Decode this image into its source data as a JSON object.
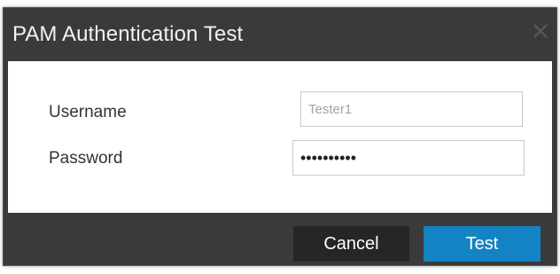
{
  "dialog": {
    "title": "PAM Authentication Test",
    "close_icon": "close-icon"
  },
  "form": {
    "username_label": "Username",
    "username_value": "Tester1",
    "password_label": "Password",
    "password_value": "••••••••••"
  },
  "footer": {
    "cancel_label": "Cancel",
    "test_label": "Test"
  },
  "colors": {
    "titlebar": "#3a3a3a",
    "cancel_button": "#262626",
    "test_button": "#1483c4",
    "body": "#ffffff"
  }
}
